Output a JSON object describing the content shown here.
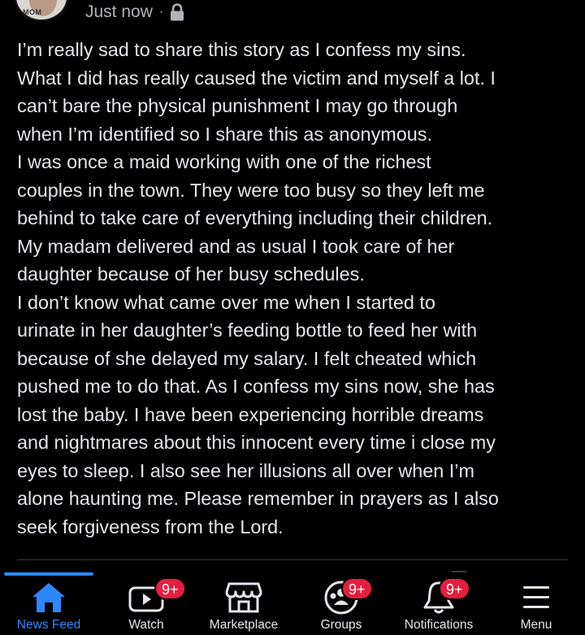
{
  "post": {
    "avatar_text": "MOM",
    "timestamp": "Just now",
    "separator": "·",
    "privacy_icon": "lock-icon",
    "lines": [
      "I’m really sad to share this story as I confess my sins.",
      "What I did has really caused the victim and myself a lot. I",
      "can’t bare the physical punishment I may go through",
      "when I’m identified so I share this as anonymous.",
      "I was once a maid working with one of the richest",
      "couples in the town. They were too busy so they left me",
      "behind to take care of everything including their children.",
      "My madam delivered and as usual I took care of her",
      "daughter because of her busy schedules.",
      "I don’t know what came over me when I started to",
      "urinate in her daughter’s feeding bottle to feed her with",
      "because of she delayed my salary. I felt cheated which",
      "pushed me to do that. As I confess my sins now, she has",
      "lost the baby. I have been experiencing horrible dreams",
      "and nightmares about this innocent every time i close my",
      "eyes to sleep. I also see her illusions all over when I’m",
      "alone haunting me. Please remember in prayers as I also",
      "seek forgiveness from the Lord."
    ]
  },
  "nav": {
    "items": [
      {
        "label": "News Feed",
        "icon": "home-icon",
        "active": true
      },
      {
        "label": "Watch",
        "icon": "video-icon",
        "badge": "9+"
      },
      {
        "label": "Marketplace",
        "icon": "shop-icon"
      },
      {
        "label": "Groups",
        "icon": "groups-icon",
        "badge": "9+"
      },
      {
        "label": "Notifications",
        "icon": "bell-icon",
        "badge": "9+"
      },
      {
        "label": "Menu",
        "icon": "menu-icon"
      }
    ]
  },
  "colors": {
    "background": "#000000",
    "text": "#e4e6eb",
    "muted": "#b0b3b8",
    "accent": "#2d88ff",
    "badge": "#e41e3f"
  }
}
